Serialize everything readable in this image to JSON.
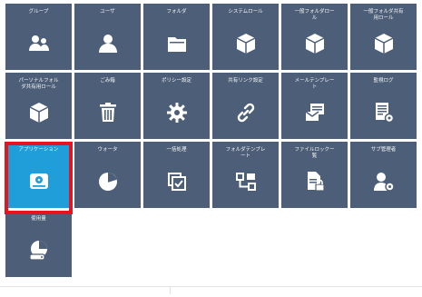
{
  "colors": {
    "tile_background": "#4d5f78",
    "selected_tile_background": "#1f9ed9",
    "highlight_border": "#e8141c",
    "icon_color": "#ffffff"
  },
  "tiles": [
    {
      "label": "グループ",
      "icon": "group-icon"
    },
    {
      "label": "ユーザ",
      "icon": "user-icon"
    },
    {
      "label": "フォルダ",
      "icon": "folder-icon"
    },
    {
      "label": "システムロール",
      "icon": "cube-icon"
    },
    {
      "label": "一般フォルダロー\nル",
      "icon": "cube-icon"
    },
    {
      "label": "一般フォルダ共有\n用ロール",
      "icon": "cube-icon"
    },
    {
      "label": "パーソナルフォル\nダ共有用ロール",
      "icon": "cube-icon"
    },
    {
      "label": "ごみ箱",
      "icon": "trash-icon"
    },
    {
      "label": "ポリシー設定",
      "icon": "gear-icon"
    },
    {
      "label": "共有リンク設定",
      "icon": "link-icon"
    },
    {
      "label": "メールテンプレー\nト",
      "icon": "mail-template-icon"
    },
    {
      "label": "監視ログ",
      "icon": "log-document-icon"
    },
    {
      "label": "アプリケーション",
      "icon": "application-drive-icon",
      "selected": true
    },
    {
      "label": "ウォータ",
      "icon": "pie-chart-icon"
    },
    {
      "label": "一括処理",
      "icon": "batch-check-icon"
    },
    {
      "label": "フォルダテンプレ\nート",
      "icon": "folder-template-icon"
    },
    {
      "label": "ファイルロックー\n覧",
      "icon": "file-lock-icon"
    },
    {
      "label": "サブ管理者",
      "icon": "sub-admin-icon"
    },
    {
      "label": "使用量",
      "icon": "usage-icon"
    }
  ]
}
